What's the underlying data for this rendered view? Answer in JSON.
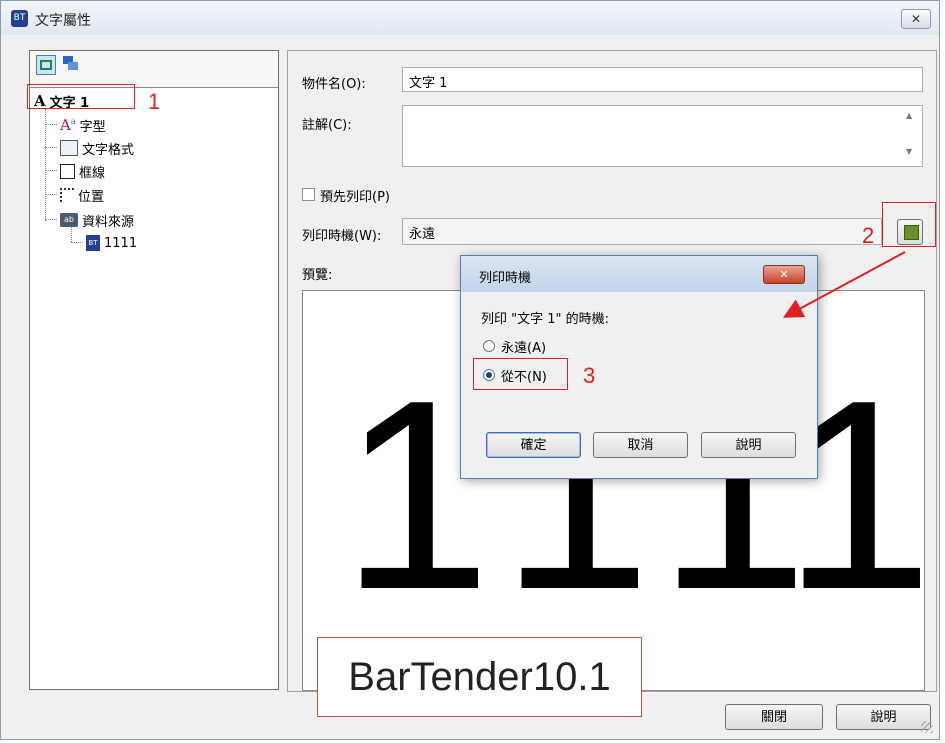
{
  "window": {
    "title": "文字屬性",
    "close_glyph": "✕",
    "app_icon_text": "BT"
  },
  "tree": {
    "items": [
      {
        "label": "文字 1",
        "icon": "text-A-icon"
      },
      {
        "label": "字型",
        "icon": "font-icon"
      },
      {
        "label": "文字格式",
        "icon": "text-format-icon"
      },
      {
        "label": "框線",
        "icon": "border-icon"
      },
      {
        "label": "位置",
        "icon": "position-icon"
      },
      {
        "label": "資料來源",
        "icon": "data-source-icon"
      },
      {
        "label": "1111",
        "icon": "bt-source-icon"
      }
    ]
  },
  "form": {
    "object_name_label": "物件名(O):",
    "object_name_value": "文字 1",
    "comment_label": "註解(C):",
    "comment_value": "",
    "preprint_label": "預先列印(P)",
    "print_when_label": "列印時機(W):",
    "print_when_value": "永遠",
    "preview_label": "預覽:",
    "preview_text": [
      "1",
      "1",
      "1",
      "1"
    ]
  },
  "dialog": {
    "title": "列印時機",
    "prompt": "列印 \"文字 1\" 的時機:",
    "options": [
      {
        "label": "永遠(A)",
        "selected": false
      },
      {
        "label": "從不(N)",
        "selected": true
      }
    ],
    "ok_label": "確定",
    "cancel_label": "取消",
    "help_label": "說明",
    "close_glyph": "✕"
  },
  "annotations": {
    "n1": "1",
    "n2": "2",
    "n3": "3",
    "color": "#e02020"
  },
  "watermark": "BarTender10.1",
  "bottom": {
    "close_label": "關閉",
    "help_label": "說明"
  }
}
